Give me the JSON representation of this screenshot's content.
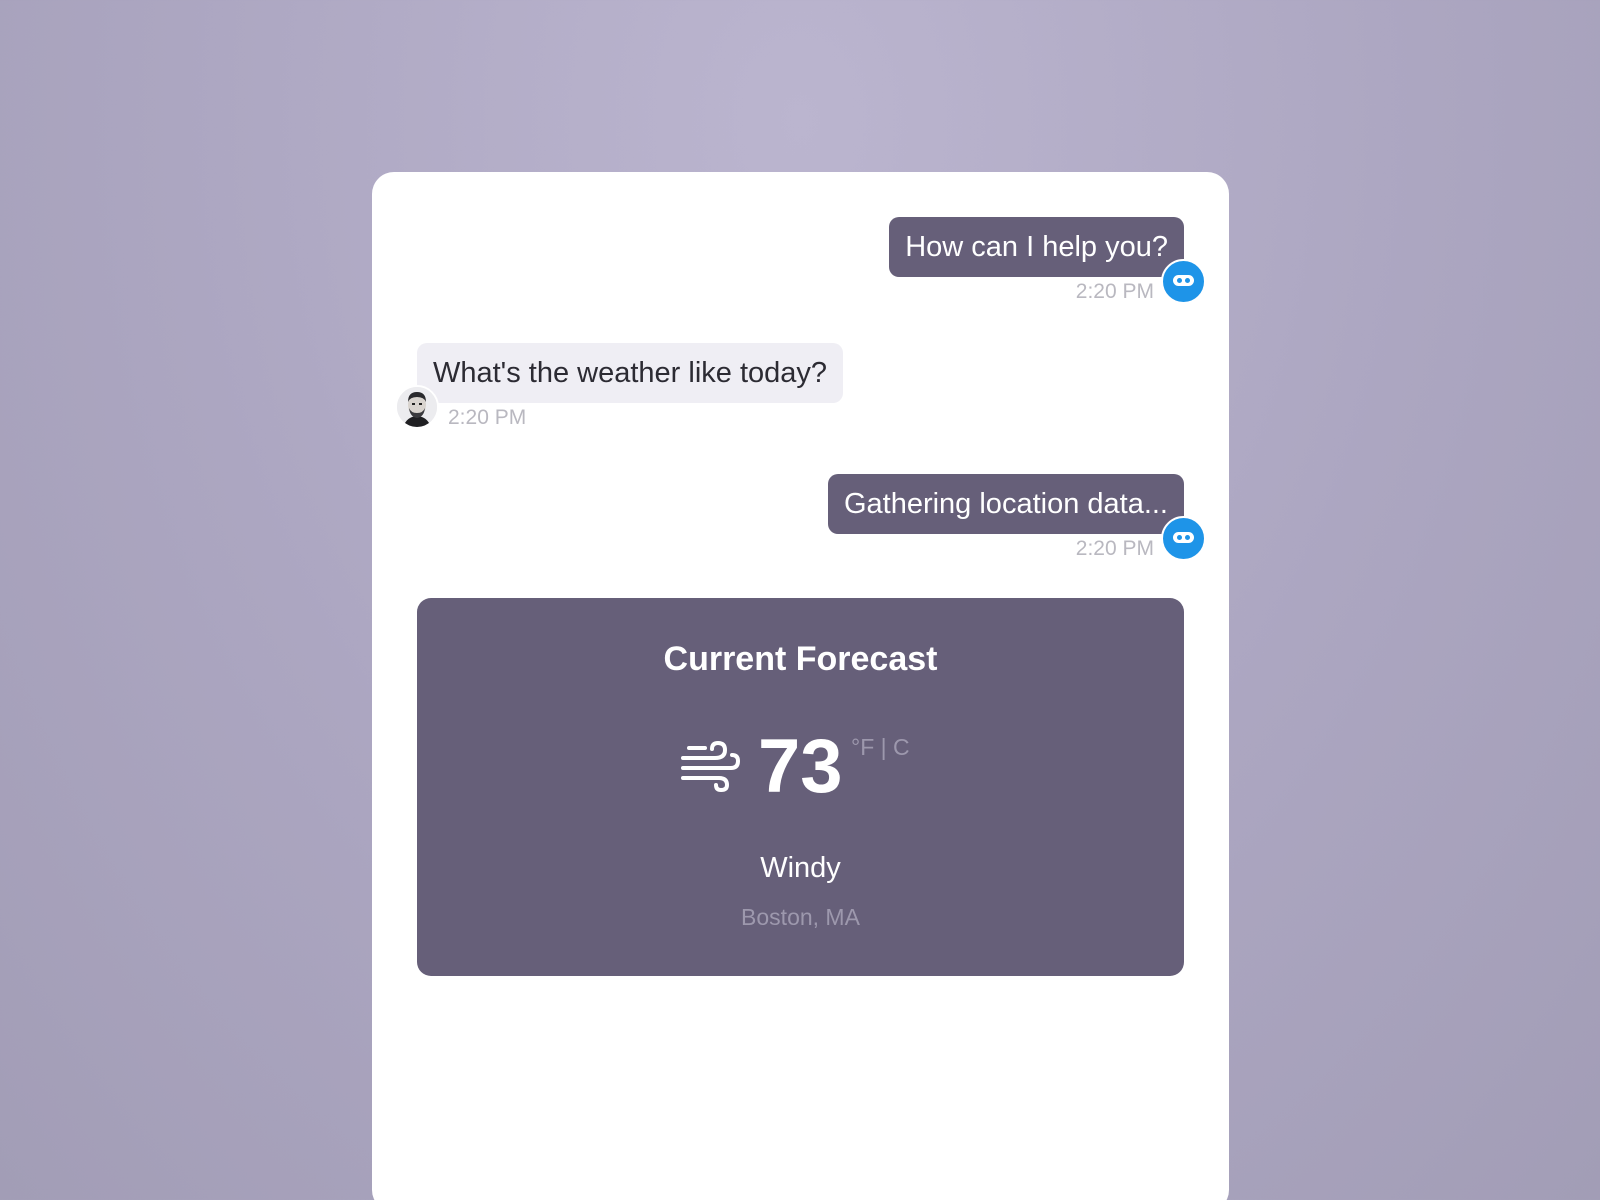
{
  "messages": [
    {
      "sender": "bot",
      "text": "How can I help you?",
      "time": "2:20 PM",
      "avatar_icon": "bot-icon"
    },
    {
      "sender": "user",
      "text": "What's the weather like today?",
      "time": "2:20 PM",
      "avatar_icon": "user-photo"
    },
    {
      "sender": "bot",
      "text": "Gathering location data...",
      "time": "2:20 PM",
      "avatar_icon": "bot-icon"
    }
  ],
  "forecast": {
    "title": "Current Forecast",
    "temperature": "73",
    "units": "°F | C",
    "condition": "Windy",
    "location": "Boston, MA",
    "condition_icon": "wind-icon"
  },
  "colors": {
    "background": "#afa9c4",
    "bot_bubble": "#665f79",
    "user_bubble": "#efeef4",
    "bot_avatar": "#1e94e8",
    "card": "#665f79"
  }
}
